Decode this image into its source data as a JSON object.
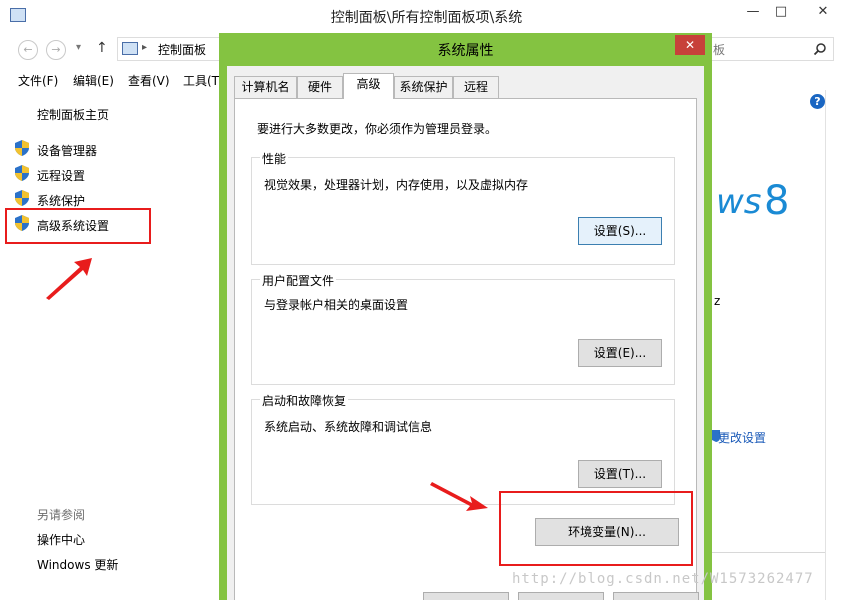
{
  "window": {
    "title": "控制面板\\所有控制面板项\\系统",
    "minimize_glyph": "—",
    "maximize_glyph": "□",
    "close_glyph": "✕"
  },
  "address": {
    "back_glyph": "←",
    "forward_glyph": "→",
    "up_glyph": "↑",
    "separator_glyph": "▸",
    "path": "控制面板",
    "search_placeholder": "板"
  },
  "menu": [
    "文件(F)",
    "编辑(E)",
    "查看(V)",
    "工具(T)"
  ],
  "left_pane": {
    "home": "控制面板主页",
    "items": [
      "设备管理器",
      "远程设置",
      "系统保护",
      "高级系统设置"
    ],
    "see_also_label": "另请参阅",
    "see_also": [
      "操作中心",
      "Windows 更新"
    ]
  },
  "right_pane": {
    "help_glyph": "?",
    "brand_text": "ws",
    "brand_number": "8",
    "partial_text": "z",
    "change_settings_link": "更改设置"
  },
  "dialog": {
    "title": "系统属性",
    "close_glyph": "✕",
    "tabs": [
      "计算机名",
      "硬件",
      "高级",
      "系统保护",
      "远程"
    ],
    "active_tab": "高级",
    "admin_note": "要进行大多数更改，你必须作为管理员登录。",
    "groups": [
      {
        "label": "性能",
        "desc": "视觉效果，处理器计划，内存使用，以及虚拟内存",
        "button": "设置(S)..."
      },
      {
        "label": "用户配置文件",
        "desc": "与登录帐户相关的桌面设置",
        "button": "设置(E)..."
      },
      {
        "label": "启动和故障恢复",
        "desc": "系统启动、系统故障和调试信息",
        "button": "设置(T)..."
      }
    ],
    "env_button": "环境变量(N)..."
  },
  "watermark": "http://blog.csdn.net/W1573262477",
  "colors": {
    "dialog_frame": "#84c341",
    "dialog_close": "#c7413a",
    "annotation": "#e81c1c",
    "brand_blue": "#1a8ad4"
  }
}
